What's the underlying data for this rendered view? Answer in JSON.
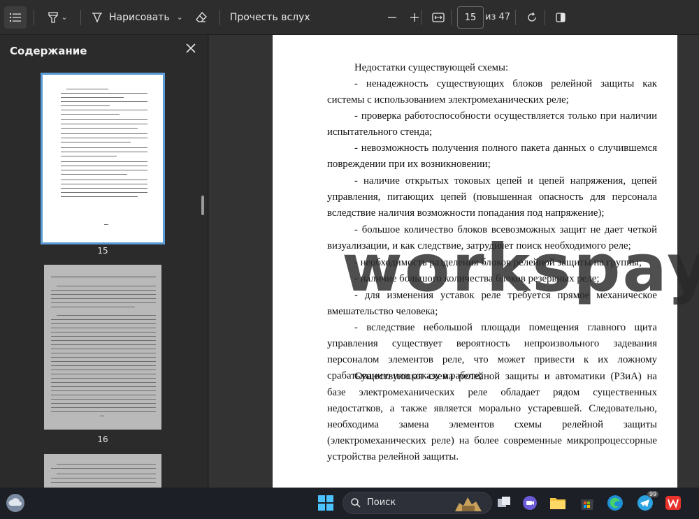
{
  "toolbar": {
    "draw_label": "Нарисовать",
    "read_aloud_label": "Прочесть вслух",
    "current_page": "15",
    "total_pages_label": "из 47"
  },
  "sidebar": {
    "title": "Содержание",
    "thumbnails": [
      {
        "page_label": "15"
      },
      {
        "page_label": "16"
      }
    ]
  },
  "document": {
    "paragraphs": [
      "Недостатки существующей схемы:",
      "- ненадежность существующих блоков релейной защиты как системы с использованием электромеханических реле;",
      "- проверка работоспособности осуществляется только при наличии испытательного стенда;",
      "- невозможность получения полного пакета данных о случившемся повреждении при их возникновении;",
      "- наличие открытых токовых цепей и цепей напряжения, цепей управления, питающих цепей (повышенная опасность для персонала вследствие наличия возможности попадания под напряжение);",
      "- большое количество блоков всевозможных защит не дает четкой визуализации, и как следствие, затрудняет поиск необходимого реле;",
      "- необходимость разделения блоков релейной защиты на группы;",
      "- наличие большого количества блоков резервных реле;",
      "- для изменения уставок реле требуется прямое механическое вмешательство человека;",
      "- вследствие небольшой площади помещения главного щита управления существует вероятность непроизвольного задевания персоналом элементов реле, что может привести к их ложному срабатыванию или отказу в работе;",
      "Существующая схема релейной защиты и автоматики (РЗиА) на базе электромеханических реле обладает рядом существенных недостатков, а также является морально устаревшей. Следовательно, необходима замена элементов схемы релейной защиты (электромеханических реле) на более современные микропроцессорные устройства релейной защиты."
    ],
    "watermark": "workspay.ru"
  },
  "taskbar": {
    "search_label": "Поиск",
    "telegram_badge": "99"
  },
  "colors": {
    "selection_outline": "#5b9bd5",
    "toolbar_bg": "#2d2d2d",
    "taskbar_bg": "#1c1f26"
  }
}
